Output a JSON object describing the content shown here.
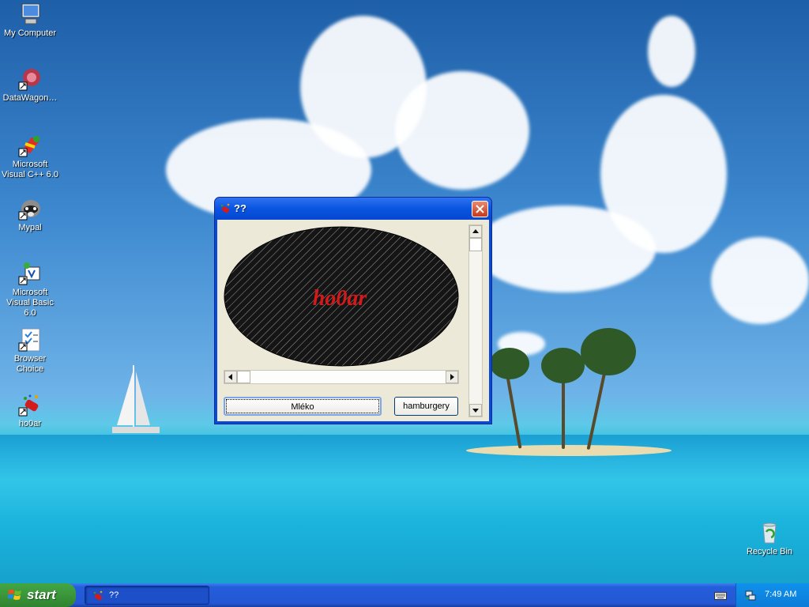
{
  "desktop": {
    "icons": [
      {
        "label": "My Computer",
        "icon": "my-computer-icon"
      },
      {
        "label": "DataWagon…",
        "icon": "datawagon-icon"
      },
      {
        "label": "Microsoft Visual C++ 6.0",
        "icon": "visual-cpp-icon"
      },
      {
        "label": "Mypal",
        "icon": "mypal-icon"
      },
      {
        "label": "Microsoft Visual Basic 6.0",
        "icon": "visual-basic-icon"
      },
      {
        "label": "Browser Choice",
        "icon": "browser-choice-icon"
      },
      {
        "label": "ho0ar",
        "icon": "ho0ar-icon"
      },
      {
        "label": "Recycle Bin",
        "icon": "recycle-bin-icon"
      }
    ]
  },
  "window": {
    "title": "??",
    "canvas_text": "ho0ar",
    "colors": {
      "ellipse_fill": "#151515",
      "hatch": "#9a9a9a",
      "text": "#d4191a"
    },
    "buttons": {
      "left": "Mléko",
      "right": "hamburgery"
    }
  },
  "taskbar": {
    "start_label": "start",
    "task_label": "??",
    "clock": "7:49 AM"
  }
}
